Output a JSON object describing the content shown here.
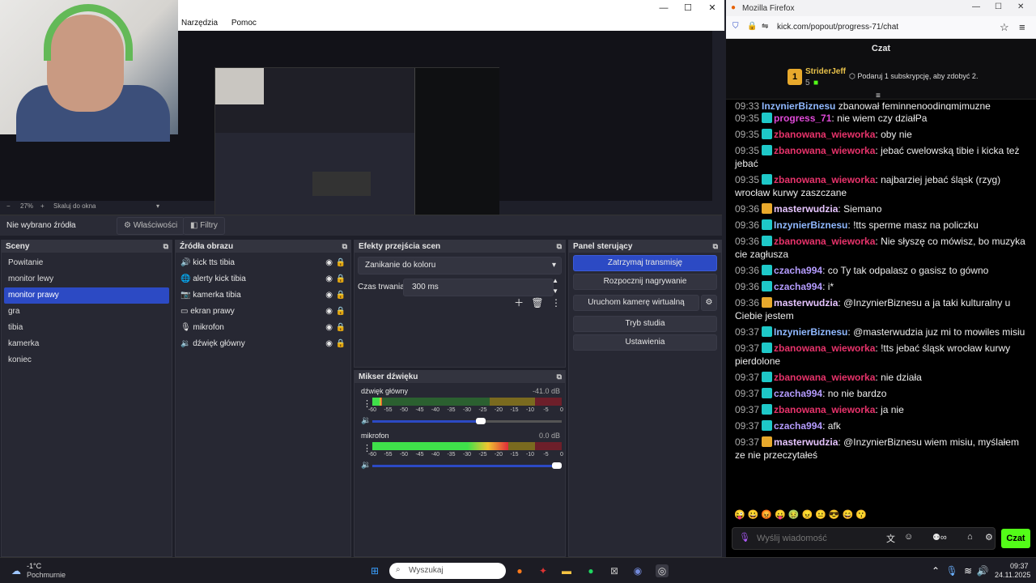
{
  "obs": {
    "menu": [
      "Narzędzia",
      "Pomoc"
    ],
    "zoom": "27%",
    "zoom_mode": "Skaluj do okna",
    "no_source": "Nie wybrano źródła",
    "properties_btn": "Właściwości",
    "filters_btn": "Filtry",
    "scenes": {
      "title": "Sceny",
      "items": [
        "Powitanie",
        "monitor lewy",
        "monitor prawy",
        "gra",
        "tibia",
        "kamerka",
        "koniec"
      ],
      "selected": 2
    },
    "sources": {
      "title": "Źródła obrazu",
      "items": [
        {
          "icon": "audio-output-icon",
          "label": "kick tts tibia"
        },
        {
          "icon": "browser-icon",
          "label": "alerty kick tibia"
        },
        {
          "icon": "camera-icon",
          "label": "kamerka tibia"
        },
        {
          "icon": "monitor-icon",
          "label": "ekran prawy"
        },
        {
          "icon": "microphone-icon",
          "label": "mikrofon"
        },
        {
          "icon": "speaker-icon",
          "label": "dźwięk główny"
        }
      ]
    },
    "transitions": {
      "title": "Efekty przejścia scen",
      "selected": "Zanikanie do koloru",
      "duration_label": "Czas trwania",
      "duration": "300 ms"
    },
    "controls": {
      "title": "Panel sterujący",
      "buttons": [
        "Zatrzymaj transmisję",
        "Rozpocznij nagrywanie",
        "Uruchom kamerę wirtualną",
        "Tryb studia",
        "Ustawienia"
      ]
    },
    "mixer": {
      "title": "Mikser dźwięku",
      "channels": [
        {
          "name": "dźwięk główny",
          "db": "-41.0 dB",
          "level": 0.05,
          "volume": 0.6
        },
        {
          "name": "mikrofon",
          "db": "0.0 dB",
          "level": 0.72,
          "volume": 1.0
        }
      ],
      "ticks": [
        "-60",
        "-55",
        "-50",
        "-45",
        "-40",
        "-35",
        "-30",
        "-25",
        "-20",
        "-15",
        "-10",
        "-5",
        "0"
      ]
    }
  },
  "firefox": {
    "title": "Mozilla Firefox",
    "url": "kick.com/popout/progress-71/chat",
    "chat_title": "Czat",
    "top_gifter": {
      "rank": "1",
      "name": "StriderJeff",
      "count": "5"
    },
    "promo": "Podaruj 1 subskrypcję, aby zdobyć 2.",
    "partial_msg": {
      "time": "09:33",
      "user": "InzynierBiznesu",
      "text": "zbanował feminnenoodingmjmuzne"
    },
    "messages": [
      {
        "time": "09:35",
        "user": "progress_71",
        "color": "#e04ad8",
        "text": "nie wiem czy działPa"
      },
      {
        "time": "09:35",
        "user": "zbanowana_wieworka",
        "color": "#e8336b",
        "text": "oby nie"
      },
      {
        "time": "09:35",
        "user": "zbanowana_wieworka",
        "color": "#e8336b",
        "text": "jebać cwelowską tibie i kicka też jebać"
      },
      {
        "time": "09:35",
        "user": "zbanowana_wieworka",
        "color": "#e8336b",
        "text": "najbarziej jebać śląsk (rzyg) wrocław kurwy zaszczane"
      },
      {
        "time": "09:36",
        "user": "masterwudzia",
        "color": "#e6c4ff",
        "text": "Siemano"
      },
      {
        "time": "09:36",
        "user": "InzynierBiznesu",
        "color": "#8fb8ff",
        "text": "!tts sperme masz na policzku"
      },
      {
        "time": "09:36",
        "user": "zbanowana_wieworka",
        "color": "#e8336b",
        "text": "Nie słyszę co mówisz, bo muzyka cie zagłusza"
      },
      {
        "time": "09:36",
        "user": "czacha994",
        "color": "#b59cff",
        "text": "co Ty tak odpalasz o gasisz to gówno"
      },
      {
        "time": "09:36",
        "user": "czacha994",
        "color": "#b59cff",
        "text": "i*"
      },
      {
        "time": "09:36",
        "user": "masterwudzia",
        "color": "#e6c4ff",
        "text": "@InzynierBiznesu a ja taki kulturalny u Ciebie jestem"
      },
      {
        "time": "09:37",
        "user": "InzynierBiznesu",
        "color": "#8fb8ff",
        "text": "@masterwudzia juz mi to mowiles misiu"
      },
      {
        "time": "09:37",
        "user": "zbanowana_wieworka",
        "color": "#e8336b",
        "text": "!tts jebać śląsk wrocław kurwy pierdolone"
      },
      {
        "time": "09:37",
        "user": "zbanowana_wieworka",
        "color": "#e8336b",
        "text": "nie działa"
      },
      {
        "time": "09:37",
        "user": "czacha994",
        "color": "#b59cff",
        "text": "no nie bardzo"
      },
      {
        "time": "09:37",
        "user": "zbanowana_wieworka",
        "color": "#e8336b",
        "text": "ja nie"
      },
      {
        "time": "09:37",
        "user": "czacha994",
        "color": "#b59cff",
        "text": "afk"
      },
      {
        "time": "09:37",
        "user": "masterwudzia",
        "color": "#e6c4ff",
        "text": "@InzynierBiznesu wiem misiu, myślałem ze nie przeczytałeś"
      }
    ],
    "input_placeholder": "Wyślij wiadomość",
    "send": "Czat"
  },
  "taskbar": {
    "weather_temp": "-1°C",
    "weather_desc": "Pochmurnie",
    "search_placeholder": "Wyszukaj",
    "time": "09:37",
    "date": "24.11.2025"
  }
}
